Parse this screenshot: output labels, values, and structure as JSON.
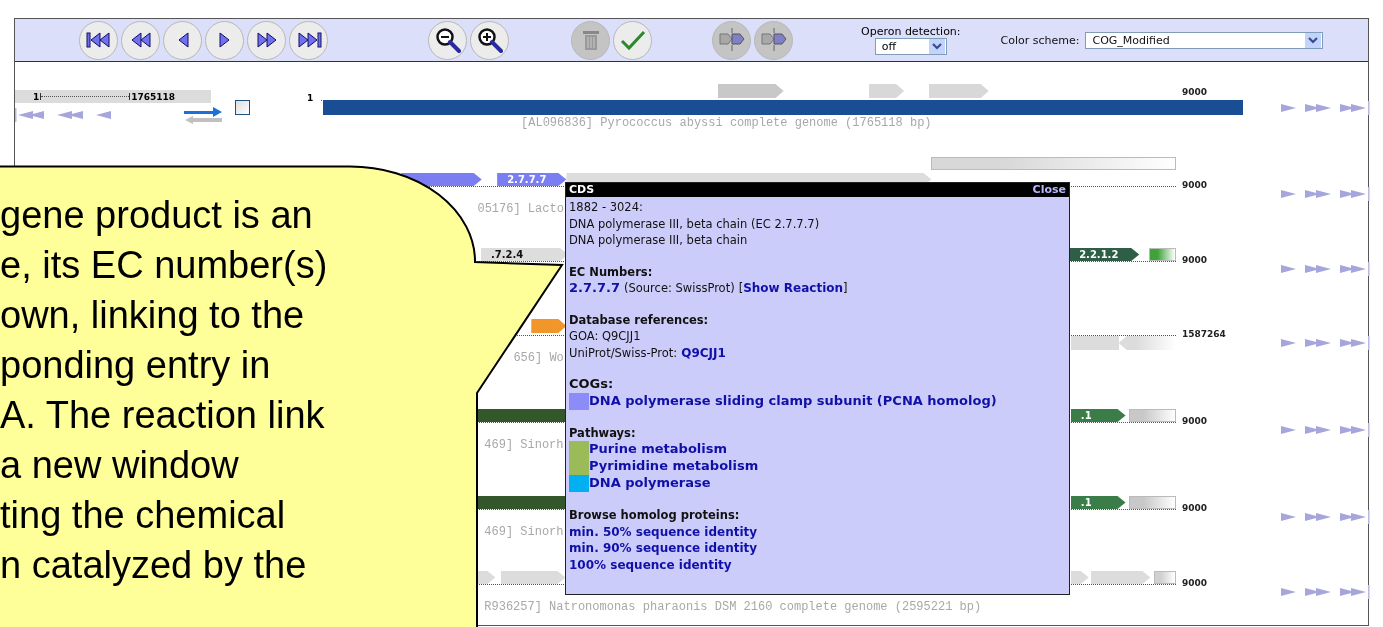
{
  "toolbar": {
    "button_groups": [
      [
        {
          "kind": "first",
          "disabled": false
        },
        {
          "kind": "rewind",
          "disabled": false
        },
        {
          "kind": "back",
          "disabled": false
        },
        {
          "kind": "forward",
          "disabled": false
        },
        {
          "kind": "fastforward",
          "disabled": false
        },
        {
          "kind": "last",
          "disabled": false
        }
      ],
      [
        {
          "kind": "zoom-out",
          "disabled": false
        },
        {
          "kind": "zoom-in",
          "disabled": false
        }
      ],
      [
        {
          "kind": "trash",
          "disabled": true
        },
        {
          "kind": "check",
          "disabled": false
        }
      ],
      [
        {
          "kind": "operon",
          "disabled": true
        },
        {
          "kind": "operon",
          "disabled": true
        }
      ]
    ],
    "operon_detection": {
      "label": "Operon detection:",
      "value": "off"
    },
    "color_scheme": {
      "label": "Color scheme:",
      "value": "COG_Modified"
    }
  },
  "tracks": [
    {
      "start": "1",
      "end": "9000",
      "label": "[AL096836] Pyrococcus abyssi complete genome (1765118 bp)",
      "controls": {
        "scale_start": "1",
        "scale_end": "1765118",
        "checked": false
      },
      "genes": [
        {
          "kind": "bar",
          "color": "#1a4e94"
        },
        {
          "kind": "arrow",
          "color": "#c8c8c8"
        },
        {
          "kind": "arrow",
          "color": "#d8d8d8"
        },
        {
          "kind": "arrow",
          "color": "#d8d8d8"
        }
      ]
    },
    {
      "end": "9000",
      "label": "05176] Lacto",
      "genes": [
        {
          "kind": "arrow",
          "color": "#7b7ef0"
        },
        {
          "kind": "arrow",
          "color": "#7b7ef0",
          "label": "2.7.7.7"
        },
        {
          "kind": "arrow",
          "color": "#dddddd"
        },
        {
          "kind": "fade",
          "color": "#d8d8d8"
        }
      ]
    },
    {
      "end": "9000",
      "genes": [
        {
          "kind": "arrow",
          "color": "#dddddd",
          "label": ".7.2.4"
        },
        {
          "kind": "arrow",
          "color": "#2e5e45",
          "label": "2.2.1.2"
        },
        {
          "kind": "fade",
          "color": "#3fa33a"
        }
      ]
    },
    {
      "end": "1587264",
      "label": "656] Wo",
      "genes": [
        {
          "kind": "arrow",
          "color": "#f0962a"
        },
        {
          "kind": "block",
          "color": "#dcdcdc"
        },
        {
          "kind": "reverse",
          "color": "#dcdcdc"
        }
      ]
    },
    {
      "end": "9000",
      "label": "469] Sinorh",
      "genes": [
        {
          "kind": "block",
          "color": "#33562a"
        },
        {
          "kind": "arrow",
          "color": "#3b7d49",
          "label": ".1"
        },
        {
          "kind": "fade",
          "color": "#c8c8c8"
        }
      ]
    },
    {
      "end": "9000",
      "label": "469] Sinorh",
      "genes": [
        {
          "kind": "block",
          "color": "#33562a"
        },
        {
          "kind": "arrow",
          "color": "#3b7d49",
          "label": ".1"
        },
        {
          "kind": "fade",
          "color": "#c8c8c8"
        }
      ]
    },
    {
      "end": "9000",
      "label": "R936257] Natronomonas pharaonis DSM 2160 complete genome (2595221 bp)",
      "genes": [
        {
          "kind": "arrow",
          "color": "#dcdcdc"
        },
        {
          "kind": "arrow",
          "color": "#dcdcdc"
        },
        {
          "kind": "arrow",
          "color": "#dcdcdc"
        },
        {
          "kind": "arrow",
          "color": "#dcdcdc"
        },
        {
          "kind": "fade",
          "color": "#d0d0d0"
        }
      ]
    }
  ],
  "popup": {
    "title": "CDS",
    "close": "Close",
    "location": "1882 - 3024:",
    "descriptions": [
      "DNA polymerase III, beta chain (EC 2.7.7.7)",
      "DNA polymerase III, beta chain"
    ],
    "ec_numbers": {
      "heading": "EC Numbers:",
      "number": "2.7.7.7",
      "source": "(Source: SwissProt)",
      "open": "[",
      "reaction_link": "Show Reaction",
      "close": "]"
    },
    "database_references": {
      "heading": "Database references:",
      "goa": "GOA: Q9CJJ1",
      "uniprot_label": "UniProt/Swiss-Prot:",
      "uniprot_link": "Q9CJJ1"
    },
    "cogs": {
      "heading": "COGs:",
      "items": [
        {
          "label": "DNA polymerase sliding clamp subunit (PCNA homolog)",
          "color": "#8c8cf8"
        }
      ]
    },
    "pathways": {
      "heading": "Pathways:",
      "items": [
        {
          "label": "Purine metabolism",
          "color": "#9bbb59"
        },
        {
          "label": "Pyrimidine metabolism",
          "color": "#9bbb59"
        },
        {
          "label": "DNA polymerase",
          "color": "#00b0f0"
        }
      ]
    },
    "homologs": {
      "heading": "Browse homolog proteins:",
      "links": [
        "min. 50% sequence identity",
        "min. 90% sequence identity",
        "100% sequence identity"
      ]
    }
  },
  "callout": {
    "lines": [
      "gene product is an",
      "e, its EC number(s)",
      "own, linking to the",
      "ponding entry in",
      "A. The reaction link",
      "a new window",
      "ting the chemical",
      "n catalyzed by the"
    ]
  }
}
